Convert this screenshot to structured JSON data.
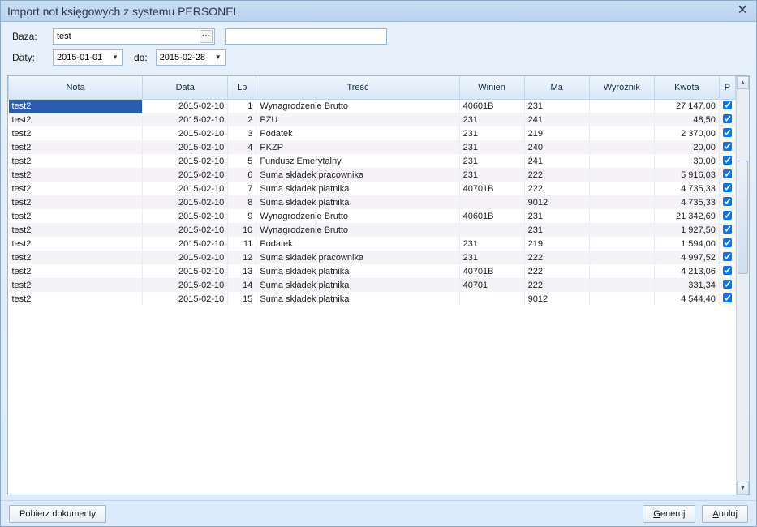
{
  "window": {
    "title": "Import not księgowych z systemu PERSONEL"
  },
  "filters": {
    "baza_label": "Baza:",
    "baza_value": "test",
    "daty_label": "Daty:",
    "date_from": "2015-01-01",
    "do_label": "do:",
    "date_to": "2015-02-28",
    "search_value": ""
  },
  "columns": {
    "nota": "Nota",
    "data": "Data",
    "lp": "Lp",
    "tresc": "Treść",
    "winien": "Winien",
    "ma": "Ma",
    "wyroznik": "Wyróżnik",
    "kwota": "Kwota",
    "p": "P"
  },
  "rows": [
    {
      "nota": "test2",
      "data": "2015-02-10",
      "lp": "1",
      "tresc": "Wynagrodzenie Brutto",
      "winien": "40601B",
      "ma": "231",
      "wyr": "",
      "kwota": "27 147,00",
      "p": true,
      "selected": true
    },
    {
      "nota": "test2",
      "data": "2015-02-10",
      "lp": "2",
      "tresc": "PZU",
      "winien": "231",
      "ma": "241",
      "wyr": "",
      "kwota": "48,50",
      "p": true
    },
    {
      "nota": "test2",
      "data": "2015-02-10",
      "lp": "3",
      "tresc": "Podatek",
      "winien": "231",
      "ma": "219",
      "wyr": "",
      "kwota": "2 370,00",
      "p": true
    },
    {
      "nota": "test2",
      "data": "2015-02-10",
      "lp": "4",
      "tresc": "PKZP",
      "winien": "231",
      "ma": "240",
      "wyr": "",
      "kwota": "20,00",
      "p": true
    },
    {
      "nota": "test2",
      "data": "2015-02-10",
      "lp": "5",
      "tresc": "Fundusz Emerytalny",
      "winien": "231",
      "ma": "241",
      "wyr": "",
      "kwota": "30,00",
      "p": true
    },
    {
      "nota": "test2",
      "data": "2015-02-10",
      "lp": "6",
      "tresc": "Suma składek pracownika",
      "winien": "231",
      "ma": "222",
      "wyr": "",
      "kwota": "5 916,03",
      "p": true
    },
    {
      "nota": "test2",
      "data": "2015-02-10",
      "lp": "7",
      "tresc": "Suma składek płatnika",
      "winien": "40701B",
      "ma": "222",
      "wyr": "",
      "kwota": "4 735,33",
      "p": true
    },
    {
      "nota": "test2",
      "data": "2015-02-10",
      "lp": "8",
      "tresc": "Suma składek płatnika",
      "winien": "",
      "ma": "9012",
      "wyr": "",
      "kwota": "4 735,33",
      "p": true
    },
    {
      "nota": "test2",
      "data": "2015-02-10",
      "lp": "9",
      "tresc": "Wynagrodzenie Brutto",
      "winien": "40601B",
      "ma": "231",
      "wyr": "",
      "kwota": "21 342,69",
      "p": true
    },
    {
      "nota": "test2",
      "data": "2015-02-10",
      "lp": "10",
      "tresc": "Wynagrodzenie Brutto",
      "winien": "",
      "ma": "231",
      "wyr": "",
      "kwota": "1 927,50",
      "p": true
    },
    {
      "nota": "test2",
      "data": "2015-02-10",
      "lp": "11",
      "tresc": "Podatek",
      "winien": "231",
      "ma": "219",
      "wyr": "",
      "kwota": "1 594,00",
      "p": true
    },
    {
      "nota": "test2",
      "data": "2015-02-10",
      "lp": "12",
      "tresc": "Suma składek pracownika",
      "winien": "231",
      "ma": "222",
      "wyr": "",
      "kwota": "4 997,52",
      "p": true
    },
    {
      "nota": "test2",
      "data": "2015-02-10",
      "lp": "13",
      "tresc": "Suma składek płatnika",
      "winien": "40701B",
      "ma": "222",
      "wyr": "",
      "kwota": "4 213,06",
      "p": true
    },
    {
      "nota": "test2",
      "data": "2015-02-10",
      "lp": "14",
      "tresc": "Suma składek płatnika",
      "winien": "40701",
      "ma": "222",
      "wyr": "",
      "kwota": "331,34",
      "p": true
    },
    {
      "nota": "test2",
      "data": "2015-02-10",
      "lp": "15",
      "tresc": "Suma składek płatnika",
      "winien": "",
      "ma": "9012",
      "wyr": "",
      "kwota": "4 544,40",
      "p": true
    }
  ],
  "buttons": {
    "pobierz": "Pobierz dokumenty",
    "generuj_pre": "",
    "generuj_u": "G",
    "generuj_post": "eneruj",
    "anuluj_pre": "",
    "anuluj_u": "A",
    "anuluj_post": "nuluj"
  }
}
